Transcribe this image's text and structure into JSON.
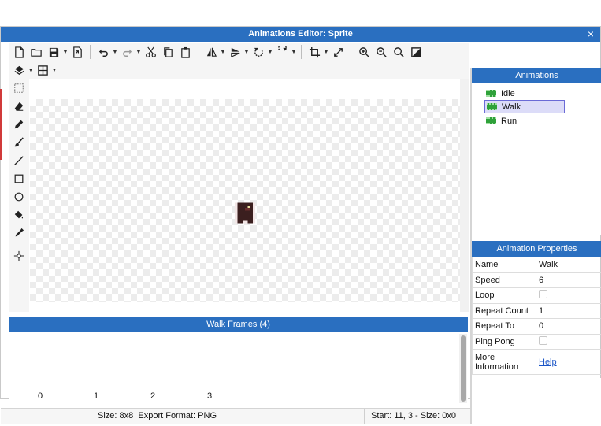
{
  "window": {
    "title": "Animations Editor: Sprite",
    "close": "×"
  },
  "animations_panel": {
    "header": "Animations",
    "items": [
      {
        "label": "Idle",
        "selected": false
      },
      {
        "label": "Walk",
        "selected": true
      },
      {
        "label": "Run",
        "selected": false
      }
    ]
  },
  "properties_panel": {
    "header": "Animation Properties",
    "rows": [
      {
        "key": "Name",
        "value": "Walk"
      },
      {
        "key": "Speed",
        "value": "6"
      },
      {
        "key": "Loop",
        "value": ""
      },
      {
        "key": "Repeat Count",
        "value": "1"
      },
      {
        "key": "Repeat To",
        "value": "0"
      },
      {
        "key": "Ping Pong",
        "value": ""
      },
      {
        "key": "More Information",
        "value": "Help"
      }
    ]
  },
  "frames_panel": {
    "header": "Walk Frames (4)",
    "indices": [
      "0",
      "1",
      "2",
      "3"
    ]
  },
  "status": {
    "size": "Size: 8x8",
    "export": "Export Format: PNG",
    "selection": "Start: 11, 3 - Size: 0x0"
  },
  "colors": {
    "accent": "#2a6fc0",
    "selection": "#dcdcf8",
    "link": "#1a55c7"
  },
  "icons": {
    "toolbar1": [
      "new-file-icon",
      "open-folder-icon",
      "save-icon",
      "export-icon",
      "undo-icon",
      "redo-icon",
      "cut-icon",
      "copy-icon",
      "paste-icon",
      "flip-horizontal-icon",
      "flip-vertical-icon",
      "rotate-left-icon",
      "rotate-right-icon",
      "crop-icon",
      "resize-icon",
      "zoom-in-icon",
      "zoom-out-icon",
      "zoom-fit-icon",
      "invert-icon"
    ],
    "toolbar2": [
      "layers-icon",
      "grid-icon"
    ],
    "tools": [
      "select-icon",
      "eraser-icon",
      "pencil-icon",
      "brush-icon",
      "line-icon",
      "rectangle-icon",
      "ellipse-icon",
      "fill-icon",
      "eyedropper-icon",
      "pivot-icon"
    ]
  }
}
